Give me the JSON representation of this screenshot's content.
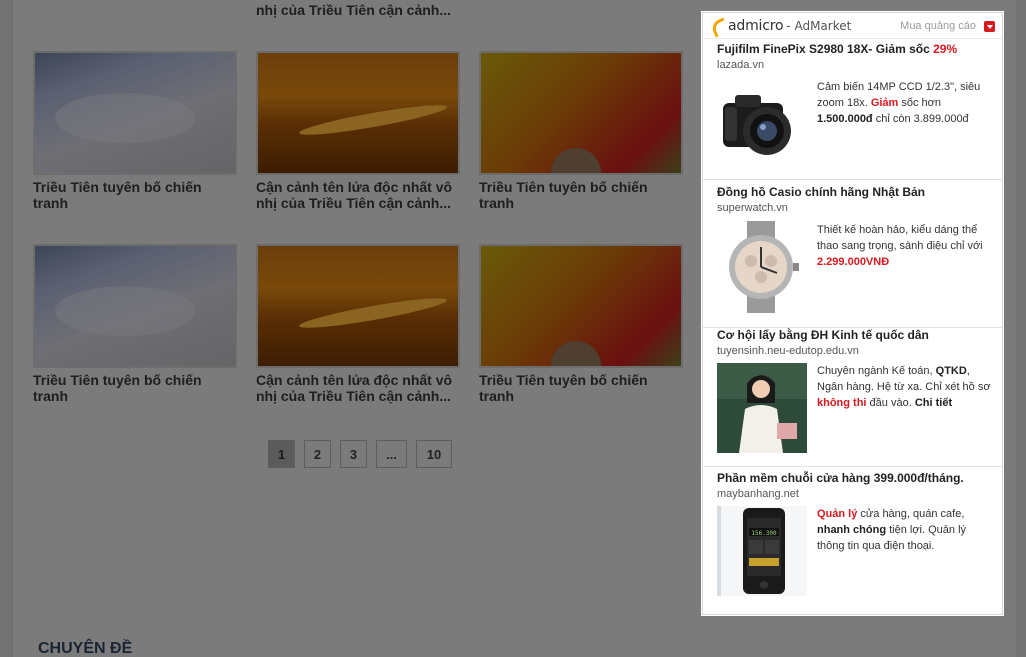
{
  "top_captions": [
    "nhị của Triều Tiên cận cảnh..."
  ],
  "grid": {
    "row1": [
      {
        "caption": "Triều Tiên tuyên bố chiến tranh",
        "thumb": "cloud-sky"
      },
      {
        "caption": "Cận cảnh tên lửa độc nhất vô nhị của Triều Tiên cận cảnh...",
        "thumb": "sunset-clouds"
      },
      {
        "caption": "Triều Tiên tuyên bố chiến tranh",
        "thumb": "red-ball"
      }
    ],
    "row2": [
      {
        "caption": "Triều Tiên tuyên bố chiến tranh",
        "thumb": "cloud-sky"
      },
      {
        "caption": "Cận cảnh tên lửa độc nhất vô nhị của Triều Tiên cận cảnh...",
        "thumb": "sunset-clouds"
      },
      {
        "caption": "Triều Tiên tuyên bố chiến tranh",
        "thumb": "red-ball"
      }
    ]
  },
  "pagination": [
    "1",
    "2",
    "3",
    "...",
    "10"
  ],
  "pagination_active": "1",
  "section_title": "CHUYÊN ĐỀ",
  "ad": {
    "logo": "admicro",
    "logo_sub": "- AdMarket",
    "buy_label": "Mua quảng cáo",
    "accent": "#d71920",
    "items": [
      {
        "title": "Fujifilm FinePix S2980 18X- Giảm sốc ",
        "title_pct": "29%",
        "site": "lazada.vn",
        "desc_1": "Cảm biến 14MP CCD 1/2.3\", siêu zoom 18x. ",
        "desc_red": "Giảm",
        "desc_2": " sốc hơn ",
        "desc_bold": "1.500.000đ",
        "desc_3": " chỉ còn 3.899.000đ",
        "img": "camera"
      },
      {
        "title": "Đồng hồ Casio chính hãng Nhật Bản",
        "site": "superwatch.vn",
        "desc_1": "Thiết kế hoàn hảo, kiểu dáng thể thao sang trọng, sành điệu chỉ với ",
        "desc_red": "2.299.000VNĐ",
        "img": "watch"
      },
      {
        "title": "Cơ hội lấy bằng ĐH Kinh tế quốc dân",
        "site": "tuyensinh.neu-edutop.edu.vn",
        "desc_1": "Chuyên ngành Kế toán, ",
        "desc_bold": "QTKD",
        "desc_2": ", Ngân hàng. Hệ từ xa. Chỉ xét hồ sơ ",
        "desc_red": "không thi",
        "desc_3": " đầu vào. ",
        "desc_bold2": "Chi tiết",
        "img": "student"
      },
      {
        "title": "Phần mềm chuỗi cửa hàng 399.000đ/tháng.",
        "site": "maybanhang.net",
        "desc_red": "Quản lý",
        "desc_1": " cửa hàng, quán cafe, ",
        "desc_bold": "nhanh chóng",
        "desc_2": " tiện lợi. Quản lý thông tin qua điện thoại.",
        "img": "phone",
        "phone_screen": "156.300"
      }
    ]
  }
}
